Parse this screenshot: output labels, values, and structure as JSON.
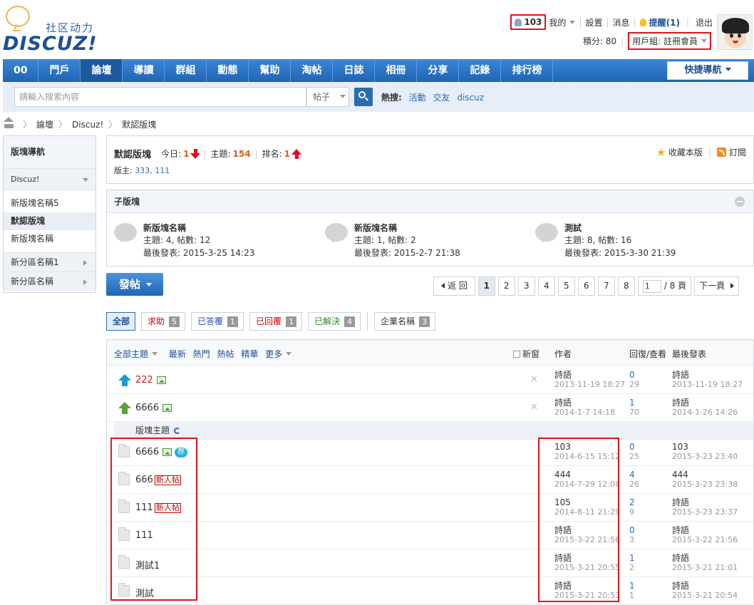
{
  "header": {
    "logo_cn": "社区动力",
    "logo_en": "DISCUZ!",
    "uid": "103",
    "menu": [
      "我的",
      "設置",
      "消息"
    ],
    "remind": "提醒(1)",
    "logout": "退出",
    "points": "積分: 80",
    "usergroup": "用戶組: 註冊會員"
  },
  "nav": {
    "items": [
      "00",
      "門戶",
      "論壇",
      "導讀",
      "群組",
      "動態",
      "幫助",
      "淘帖",
      "日誌",
      "相冊",
      "分享",
      "記錄",
      "排行榜"
    ],
    "active": "論壇",
    "quick": "快捷導航"
  },
  "search": {
    "placeholder": "請輸入搜索內容",
    "type": "帖子",
    "hot_label": "熱搜:",
    "hot": [
      "活動",
      "交友",
      "discuz"
    ]
  },
  "breadcrumb": [
    "論壇",
    "Discuz!",
    "默認版塊"
  ],
  "sidebar": {
    "title": "版塊導航",
    "group": "Discuz!",
    "items": [
      "新版塊名稱5",
      "默認版塊",
      "新版塊名稱"
    ],
    "sections": [
      "新分區名稱1",
      "新分區名稱"
    ]
  },
  "forum": {
    "name": "默認版塊",
    "today_label": "今日:",
    "today": "1",
    "topics_label": "主題:",
    "topics": "154",
    "rank_label": "排名:",
    "rank": "1",
    "mods_label": "版主:",
    "mods": "333, 111",
    "fav": "收藏本版",
    "rss": "訂閱"
  },
  "subforums": {
    "title": "子版塊",
    "items": [
      {
        "name": "新版塊名稱",
        "stats": "主題: 4, 帖數: 12",
        "last": "最後發表: 2015-3-25 14:23"
      },
      {
        "name": "新版塊名稱",
        "stats": "主題: 1, 帖數: 2",
        "last": "最後發表: 2015-2-7 21:38"
      },
      {
        "name": "測試",
        "stats": "主題: 8, 帖數: 16",
        "last": "最後發表: 2015-3-30 21:39"
      }
    ]
  },
  "post_button": "發帖",
  "pager": {
    "back": "返 回",
    "pages": [
      "1",
      "2",
      "3",
      "4",
      "5",
      "6",
      "7",
      "8"
    ],
    "current": "1",
    "input": "1",
    "total": "/ 8 頁",
    "next": "下一頁"
  },
  "filters": [
    {
      "label": "全部",
      "count": "",
      "style": "act"
    },
    {
      "label": "求助",
      "count": "5",
      "style": "red"
    },
    {
      "label": "已答覆",
      "count": "1",
      "style": "blue"
    },
    {
      "label": "已回覆",
      "count": "1",
      "style": "red"
    },
    {
      "label": "已解決",
      "count": "4",
      "style": "grn"
    },
    {
      "label": "企業名稱",
      "count": "3",
      "style": ""
    }
  ],
  "thread_head": {
    "all": "全部主題",
    "tabs": [
      "最新",
      "熱門",
      "熱帖",
      "精華",
      "更多"
    ],
    "newwin": "新窗",
    "author": "作者",
    "replies": "回復/查看",
    "last": "最後發表"
  },
  "section_label": "版塊主題",
  "threads": [
    {
      "title": "222",
      "author": "詩語",
      "date": "2013-11-19 18:27",
      "replies": "0",
      "views": "29",
      "lp_author": "詩語",
      "lp_date": "2013-11-19 18:27"
    },
    {
      "title": "6666",
      "author": "詩語",
      "date": "2014-1-7 14:18",
      "replies": "1",
      "views": "70",
      "lp_author": "詩語",
      "lp_date": "2014-1-26 14:26"
    },
    {
      "title": "6666",
      "badge": "荐",
      "author": "103",
      "date": "2014-6-15 15:12",
      "replies": "0",
      "views": "25",
      "lp_author": "103",
      "lp_date": "2015-3-23 23:40"
    },
    {
      "title": "666",
      "badge": "新人帖",
      "author": "444",
      "date": "2014-7-29 12:08",
      "replies": "4",
      "views": "26",
      "lp_author": "444",
      "lp_date": "2015-3-23 23:38"
    },
    {
      "title": "111",
      "badge": "新人帖",
      "author": "105",
      "date": "2014-8-11 21:29",
      "replies": "2",
      "views": "9",
      "lp_author": "詩語",
      "lp_date": "2015-3-23 23:37"
    },
    {
      "title": "111",
      "author": "詩語",
      "date": "2015-3-22 21:56",
      "replies": "0",
      "views": "3",
      "lp_author": "詩語",
      "lp_date": "2015-3-22 21:56"
    },
    {
      "title": "測試1",
      "author": "詩語",
      "date": "2015-3-21 20:55",
      "replies": "1",
      "views": "2",
      "lp_author": "詩語",
      "lp_date": "2015-3-21 21:01"
    },
    {
      "title": "測試",
      "author": "詩語",
      "date": "2015-3-21 20:53",
      "replies": "1",
      "views": "1",
      "lp_author": "詩語",
      "lp_date": "2015-3-21 20:54"
    }
  ]
}
